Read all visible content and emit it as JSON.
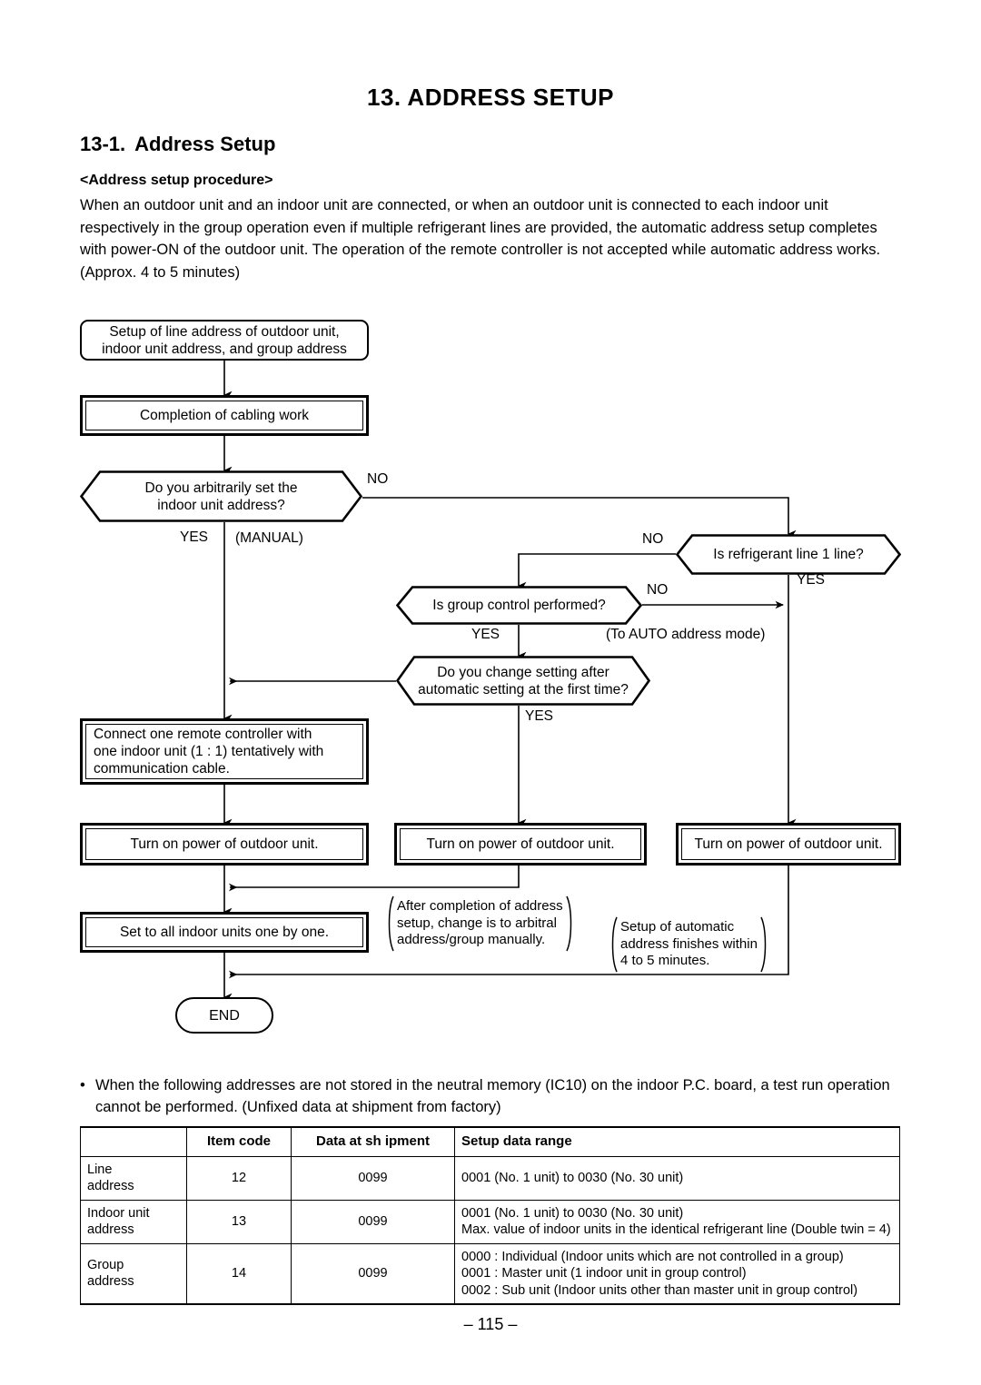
{
  "document": {
    "chapter_title": "13.  ADDRESS SETUP",
    "section_number": "13-1.",
    "section_title": "Address Setup",
    "procedure_heading": "<Address setup procedure>",
    "intro_paragraph": "When an outdoor unit and an indoor unit are connected, or when an outdoor unit is connected to each indoor unit respectively in the group operation even if multiple refrigerant lines are provided, the automatic address setup completes with power-ON of the outdoor unit. The operation of the remote controller is not accepted while automatic address works. (Approx. 4 to 5 minutes)",
    "page_number": "– 115 –"
  },
  "flowchart": {
    "nodes": {
      "start_setup": "Setup of line address of outdoor unit,\nindoor unit address, and group address",
      "cabling_complete": "Completion of cabling work",
      "decision_arbitrary": "Do you arbitrarily set the\nindoor unit address?",
      "decision_refrigerant": "Is refrigerant line 1 line?",
      "decision_group_control": "Is group control performed?",
      "decision_change_setting": "Do you change setting after\nautomatic setting at the first time?",
      "connect_remote": "Connect one remote controller with\none indoor unit (1 : 1) tentatively with\ncommunication cable.",
      "power_on_left": "Turn on power of outdoor unit.",
      "power_on_middle": "Turn on power of outdoor unit.",
      "power_on_right": "Turn on power of outdoor unit.",
      "set_all_indoor": "Set to all indoor units one by one.",
      "end": "END"
    },
    "labels": {
      "no_arbitrary": "NO",
      "yes_arbitrary": "YES",
      "manual": "(MANUAL)",
      "no_refrigerant": "NO",
      "yes_refrigerant": "YES",
      "no_group_control": "NO",
      "yes_group_control": "YES",
      "auto_address_mode": "(To AUTO address mode)",
      "yes_change_setting": "YES"
    },
    "notes": {
      "manual_change": "After completion of address\nsetup, change is to arbitral\naddress/group manually.",
      "auto_finish": "Setup of automatic\naddress finishes within\n4 to 5 minutes."
    }
  },
  "bullet_note": {
    "marker": "•",
    "text": "When the following addresses are not stored in the neutral memory (IC10) on the indoor P.C. board, a test run operation cannot be performed. (Unfixed data at shipment from factory)"
  },
  "table": {
    "headers": [
      "",
      "Item code",
      "Data at sh  ipment",
      "Setup data range"
    ],
    "rows": [
      {
        "label": "Line\naddress",
        "item_code": "12",
        "data_at_shipment": "0099",
        "setup_data_range": "0001 (No. 1 unit) to 0030 (No. 30 unit)"
      },
      {
        "label": "Indoor unit\naddress",
        "item_code": "13",
        "data_at_shipment": "0099",
        "setup_data_range": "0001 (No. 1 unit) to 0030 (No. 30 unit)\nMax. value of indoor units in the identical refrigerant line (Double twin = 4)"
      },
      {
        "label": "Group\naddress",
        "item_code": "14",
        "data_at_shipment": "0099",
        "setup_data_range": "0000 : Individual (Indoor units which are not controlled in a group)\n0001 : Master unit (1 indoor unit in group control)\n0002 : Sub unit (Indoor units other than master unit in group control)"
      }
    ]
  }
}
